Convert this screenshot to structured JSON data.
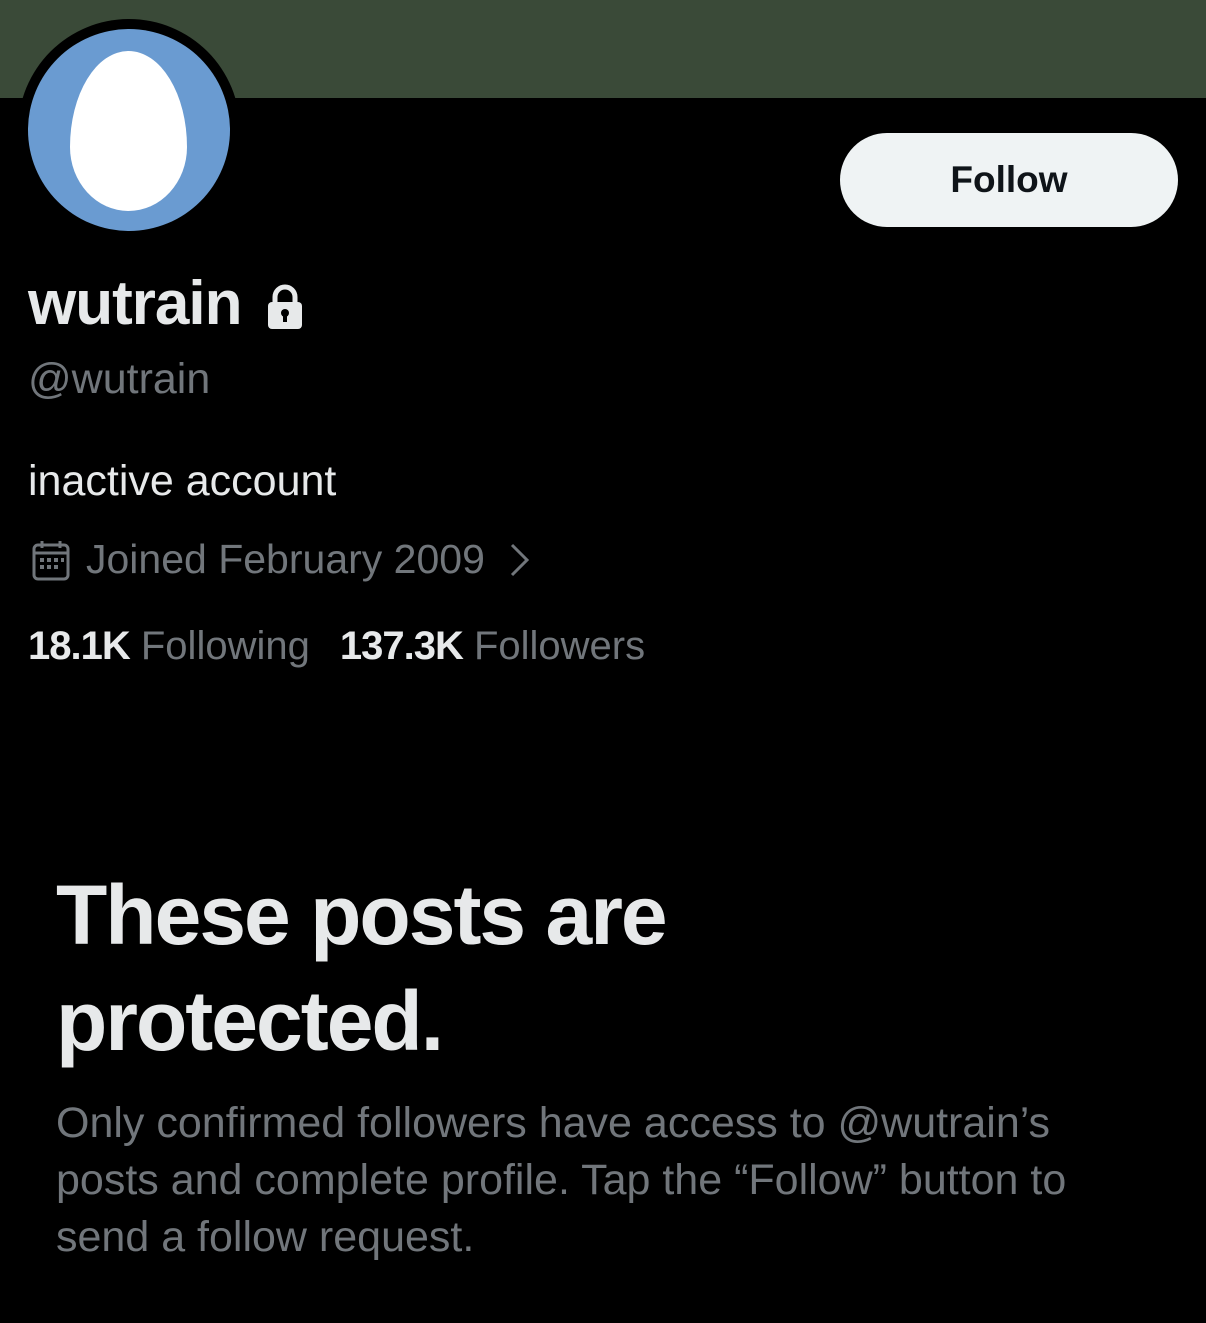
{
  "profile": {
    "display_name": "wutrain",
    "handle": "@wutrain",
    "bio": "inactive account",
    "joined": "Joined February 2009",
    "following_count": "18.1K",
    "following_label": "Following",
    "followers_count": "137.3K",
    "followers_label": "Followers"
  },
  "actions": {
    "follow_label": "Follow"
  },
  "protected": {
    "title": "These posts are protected.",
    "body": "Only confirmed followers have access to @wutrain’s posts and complete profile. Tap the “Follow” button to send a follow request."
  },
  "icons": {
    "lock": "lock-icon",
    "calendar": "calendar-icon",
    "chevron": "chevron-right-icon",
    "avatar": "default-egg-avatar"
  },
  "colors": {
    "banner": "#3a4a38",
    "avatar_bg": "#6a9bd1",
    "background": "#000000",
    "primary_text": "#e7e9ea",
    "secondary_text": "#71767b",
    "button_bg": "#eff3f4"
  }
}
